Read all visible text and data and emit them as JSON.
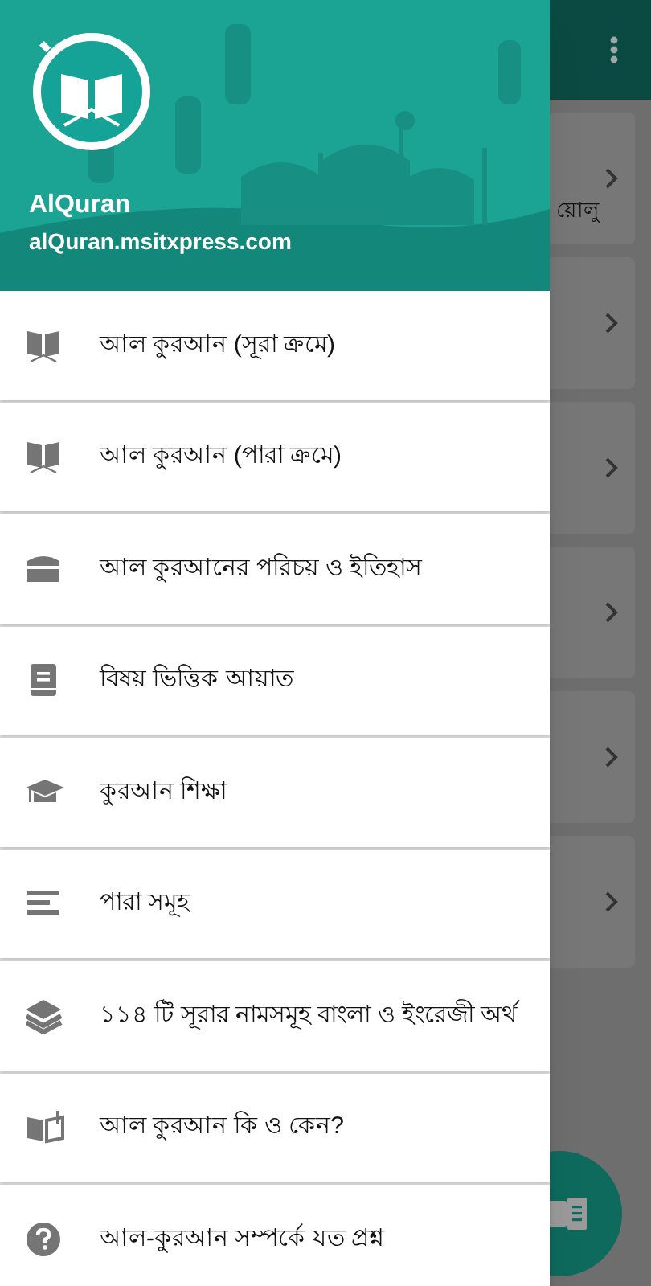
{
  "drawer": {
    "title": "AlQuran",
    "subtitle": "alQuran.msitxpress.com",
    "items": [
      {
        "label": "আল কুরআন (সূরা ক্রমে)"
      },
      {
        "label": "আল কুরআন (পারা ক্রমে)"
      },
      {
        "label": "আল কুরআনের পরিচয় ও ইতিহাস"
      },
      {
        "label": "বিষয় ভিত্তিক আয়াত"
      },
      {
        "label": "কুরআন শিক্ষা"
      },
      {
        "label": "পারা সমূহ"
      },
      {
        "label": "১১৪ টি সূরার নামসমূহ বাংলা ও ইংরেজী অর্থ"
      },
      {
        "label": "আল কুরআন কি ও কেন?"
      },
      {
        "label": "আল-কুরআন সম্পর্কে যত প্রশ্ন"
      }
    ]
  },
  "background": {
    "first_card_text": "য়োলু"
  }
}
